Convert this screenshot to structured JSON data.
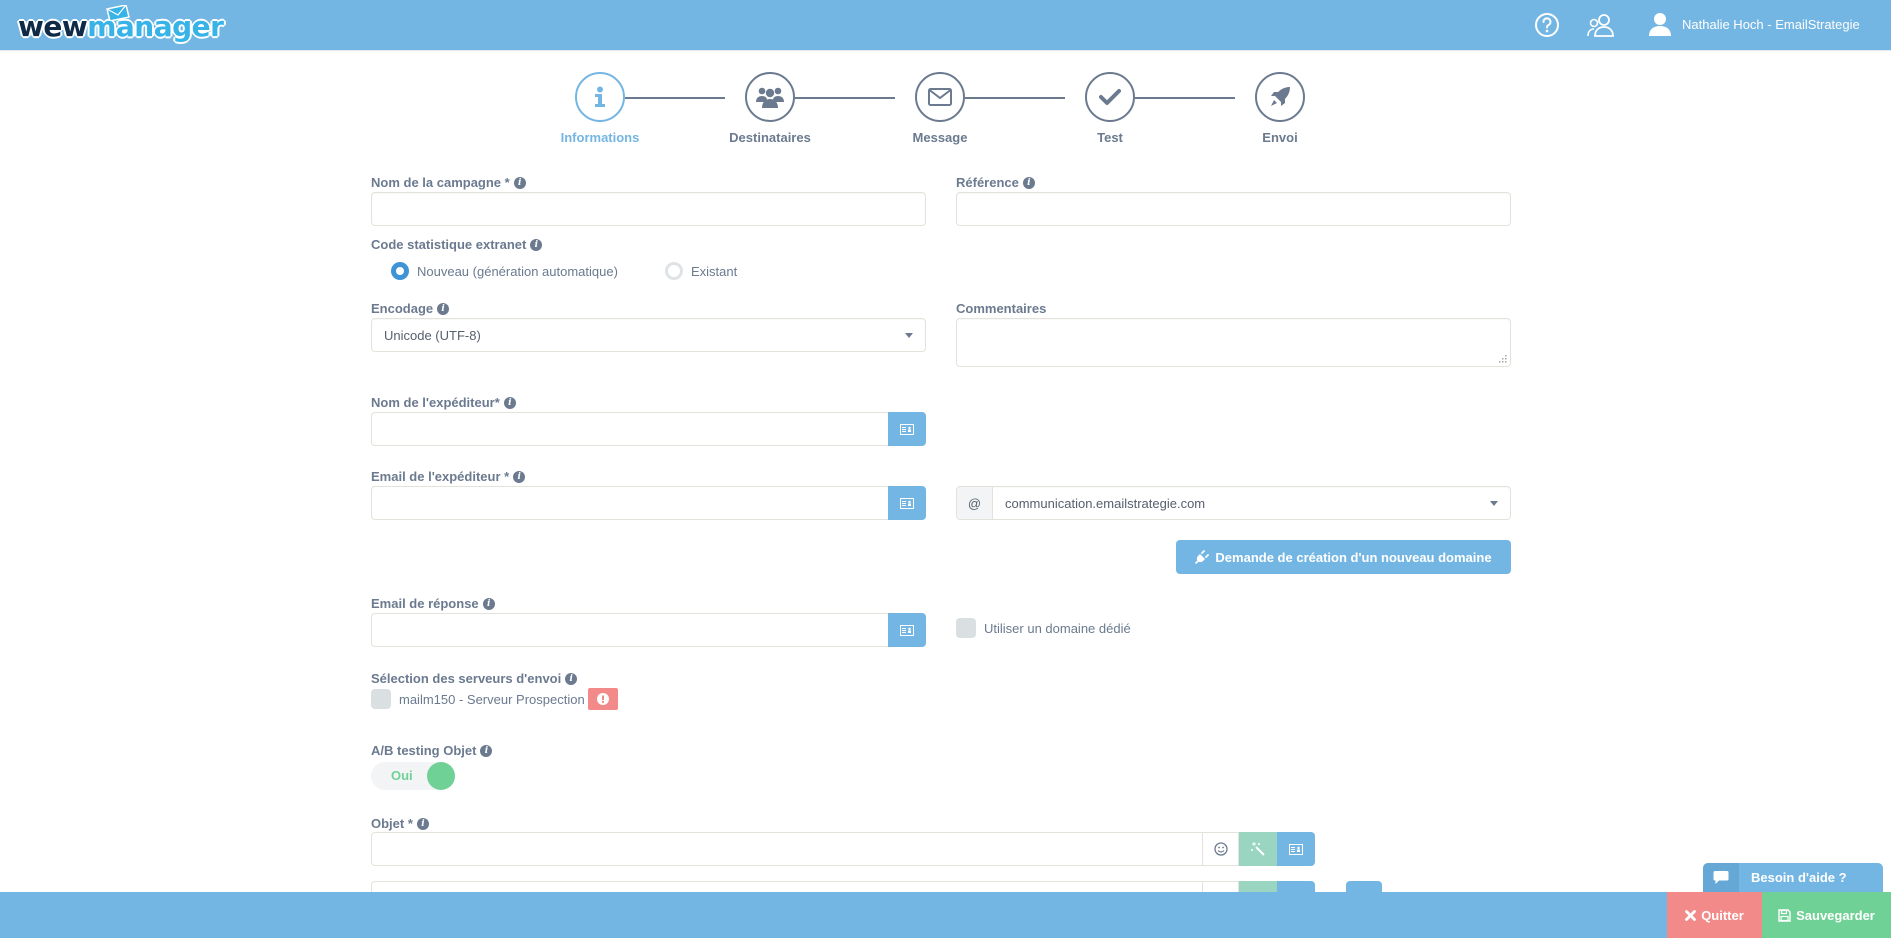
{
  "header": {
    "logo_part1": "wew",
    "logo_part2": "manager",
    "user_name": "Nathalie Hoch - EmailStrategie",
    "icons": [
      "help-circle-icon",
      "users-icon",
      "user-icon"
    ]
  },
  "stepper": {
    "steps": [
      {
        "label": "Informations",
        "icon": "info-icon",
        "active": true
      },
      {
        "label": "Destinataires",
        "icon": "group-icon",
        "active": false
      },
      {
        "label": "Message",
        "icon": "envelope-icon",
        "active": false
      },
      {
        "label": "Test",
        "icon": "check-icon",
        "active": false
      },
      {
        "label": "Envoi",
        "icon": "rocket-icon",
        "active": false
      }
    ]
  },
  "form": {
    "campaign_name": {
      "label": "Nom de la campagne *",
      "value": ""
    },
    "reference": {
      "label": "Référence",
      "value": ""
    },
    "stat_code": {
      "label": "Code statistique extranet",
      "options": [
        "Nouveau (génération automatique)",
        "Existant"
      ],
      "selected": "Nouveau (génération automatique)"
    },
    "encoding": {
      "label": "Encodage",
      "value": "Unicode (UTF-8)"
    },
    "comments": {
      "label": "Commentaires",
      "value": ""
    },
    "sender_name": {
      "label": "Nom de l'expéditeur*",
      "value": ""
    },
    "sender_email": {
      "label": "Email de l'expéditeur *",
      "value": ""
    },
    "domain": {
      "prefix": "@",
      "value": "communication.emailstrategie.com"
    },
    "new_domain_button": "Demande de création d'un nouveau domaine",
    "reply_email": {
      "label": "Email de réponse",
      "value": ""
    },
    "dedicated_domain": {
      "label": "Utiliser un domaine dédié",
      "checked": false
    },
    "servers": {
      "label": "Sélection des serveurs d'envoi",
      "items": [
        {
          "label": "mailm150 - Serveur Prospection",
          "checked": false,
          "warning": true
        }
      ]
    },
    "ab_testing": {
      "label": "A/B testing Objet",
      "value": "Oui",
      "on": true
    },
    "subject": {
      "label": "Objet *",
      "value": ""
    }
  },
  "footer": {
    "help_label": "Besoin d'aide ?",
    "quit_label": "Quitter",
    "save_label": "Sauvegarder"
  },
  "colors": {
    "primary": "#74b6e3",
    "text": "#6b7a8f",
    "success": "#6fd196",
    "danger": "#f28a8a",
    "wand": "#9ad5c2"
  }
}
